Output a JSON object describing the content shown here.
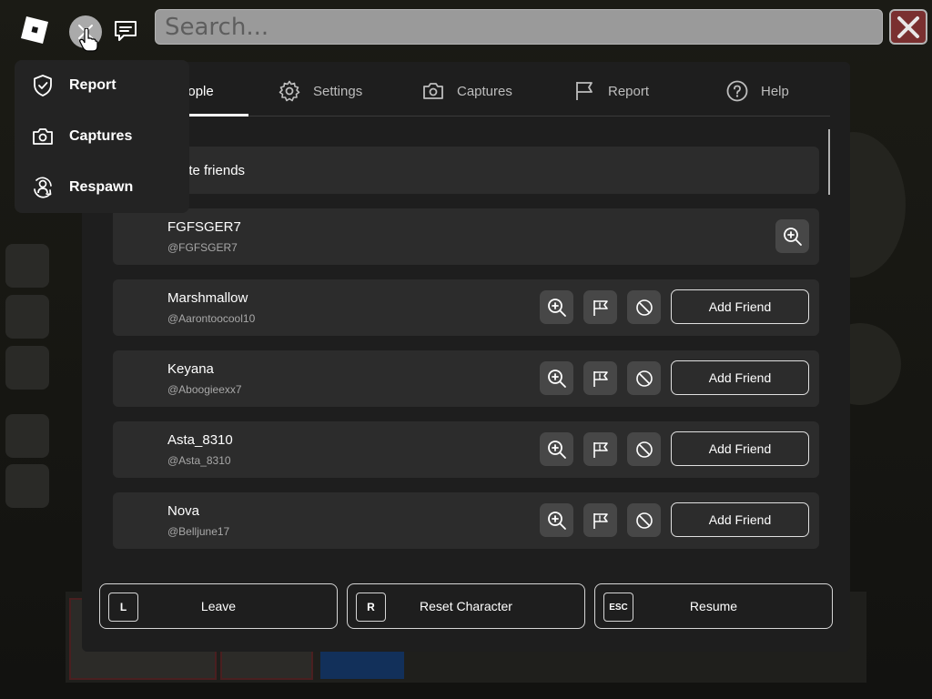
{
  "search": {
    "placeholder": "Search..."
  },
  "tabs": [
    {
      "label": "People",
      "icon": "people-icon",
      "active": true
    },
    {
      "label": "Settings",
      "icon": "gear-icon",
      "active": false
    },
    {
      "label": "Captures",
      "icon": "camera-icon",
      "active": false
    },
    {
      "label": "Report",
      "icon": "flag-icon",
      "active": false
    },
    {
      "label": "Help",
      "icon": "help-icon",
      "active": false
    }
  ],
  "invite": {
    "label": "Invite friends"
  },
  "players": [
    {
      "name": "FGFSGER7",
      "handle": "@FGFSGER7",
      "add_label": ""
    },
    {
      "name": "Marshmallow",
      "handle": "@Aarontoocool10",
      "add_label": "Add Friend"
    },
    {
      "name": "Keyana",
      "handle": "@Aboogieexx7",
      "add_label": "Add Friend"
    },
    {
      "name": "Asta_8310",
      "handle": "@Asta_8310",
      "add_label": "Add Friend"
    },
    {
      "name": "Nova",
      "handle": "@Belljune17",
      "add_label": "Add Friend"
    }
  ],
  "bottom": {
    "leave": {
      "key": "L",
      "label": "Leave"
    },
    "reset": {
      "key": "R",
      "label": "Reset Character"
    },
    "resume": {
      "key": "ESC",
      "label": "Resume"
    }
  },
  "dropdown": {
    "items": [
      {
        "label": "Report",
        "icon": "shield-check-icon"
      },
      {
        "label": "Captures",
        "icon": "camera-icon"
      },
      {
        "label": "Respawn",
        "icon": "respawn-icon"
      }
    ]
  },
  "colors": {
    "panel": "#1e1e1e",
    "row": "#2c2c2c",
    "icon_button": "#474747",
    "close_button": "#7a3030"
  }
}
